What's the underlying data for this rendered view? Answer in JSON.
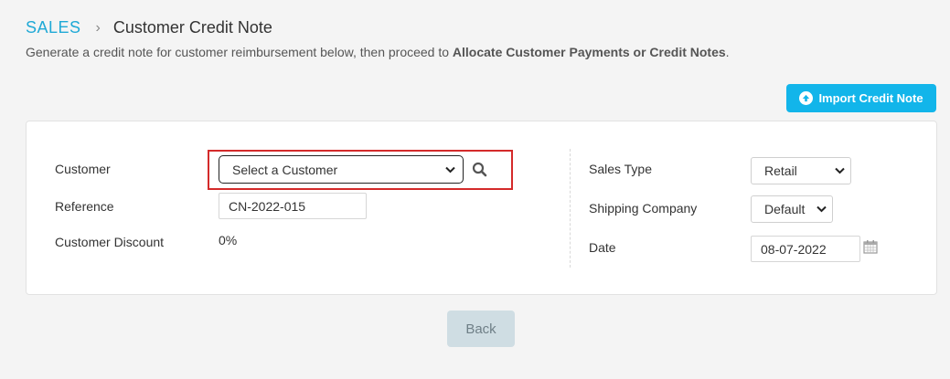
{
  "breadcrumb": {
    "section": "SALES",
    "separator": "›",
    "current": "Customer Credit Note"
  },
  "subtitle": {
    "text": "Generate a credit note for customer reimbursement below, then proceed to ",
    "bold": "Allocate Customer Payments or Credit Notes",
    "end": "."
  },
  "import_button": {
    "label": "Import Credit Note",
    "icon": "arrow-up-circle-icon"
  },
  "form_left": {
    "customer_label": "Customer",
    "customer_value": "Select a Customer",
    "reference_label": "Reference",
    "reference_value": "CN-2022-015",
    "discount_label": "Customer Discount",
    "discount_value": "0%"
  },
  "form_right": {
    "sales_type_label": "Sales Type",
    "sales_type_value": "Retail",
    "shipping_label": "Shipping Company",
    "shipping_value": "Default",
    "date_label": "Date",
    "date_value": "08-07-2022"
  },
  "back_button": {
    "label": "Back"
  },
  "colors": {
    "accent": "#1fa9d6",
    "button": "#12b5ea",
    "highlight": "#d42a2a",
    "back_button": "#cfdde3"
  }
}
